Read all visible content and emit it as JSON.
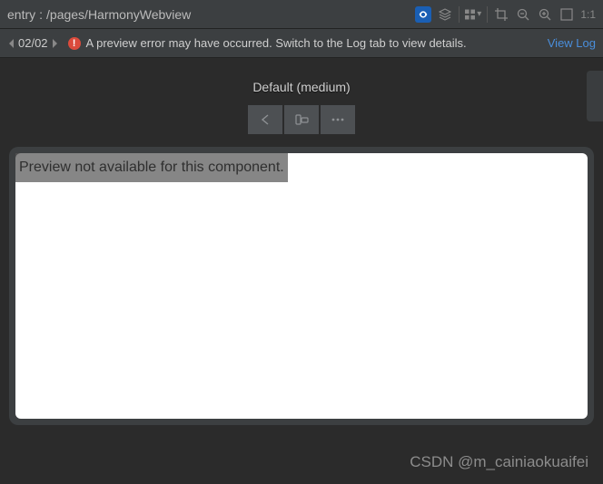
{
  "breadcrumb": {
    "entry": "entry",
    "separator": ":",
    "path": "/pages/HarmonyWebview"
  },
  "toolbar": {
    "ratio": "1:1"
  },
  "nav": {
    "page_indicator": "02/02"
  },
  "error": {
    "icon_glyph": "!",
    "message": "A preview error may have occurred. Switch to the Log tab to view details.",
    "view_log": "View Log"
  },
  "preview": {
    "title": "Default (medium)",
    "unavailable": "Preview not available for this component."
  },
  "watermark": "CSDN @m_cainiaokuaifei"
}
